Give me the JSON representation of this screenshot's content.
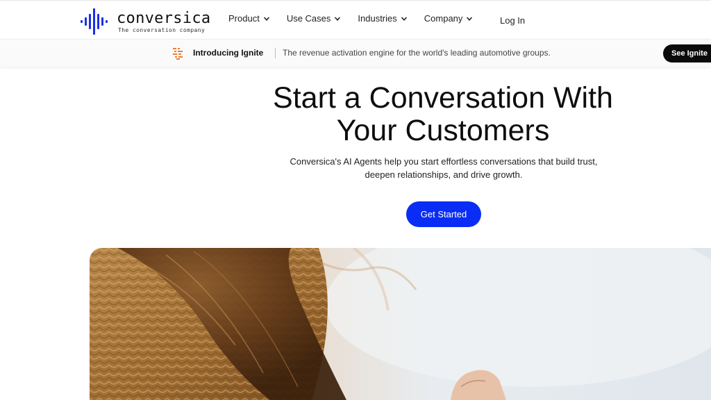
{
  "brand": {
    "name": "conversica",
    "tagline": "The conversation company",
    "accent_color": "#1a2ee6"
  },
  "nav": {
    "items": [
      {
        "label": "Product",
        "icon": "chevron-down-icon"
      },
      {
        "label": "Use Cases",
        "icon": "chevron-down-icon"
      },
      {
        "label": "Industries",
        "icon": "chevron-down-icon"
      },
      {
        "label": "Company",
        "icon": "chevron-down-icon"
      }
    ],
    "login_label": "Log In"
  },
  "announcement": {
    "icon": "ignite-icon",
    "title": "Introducing Ignite",
    "description": "The revenue activation engine for the world's leading automotive groups.",
    "button_label": "See Ignite"
  },
  "hero": {
    "title_line1": "Start a Conversation With",
    "title_line2": "Your Customers",
    "subtitle_line1": "Conversica's AI Agents help you start effortless conversations that build trust,",
    "subtitle_line2": "deepen relationships, and drive growth.",
    "cta_label": "Get Started",
    "cta_color": "#0a2df5"
  }
}
